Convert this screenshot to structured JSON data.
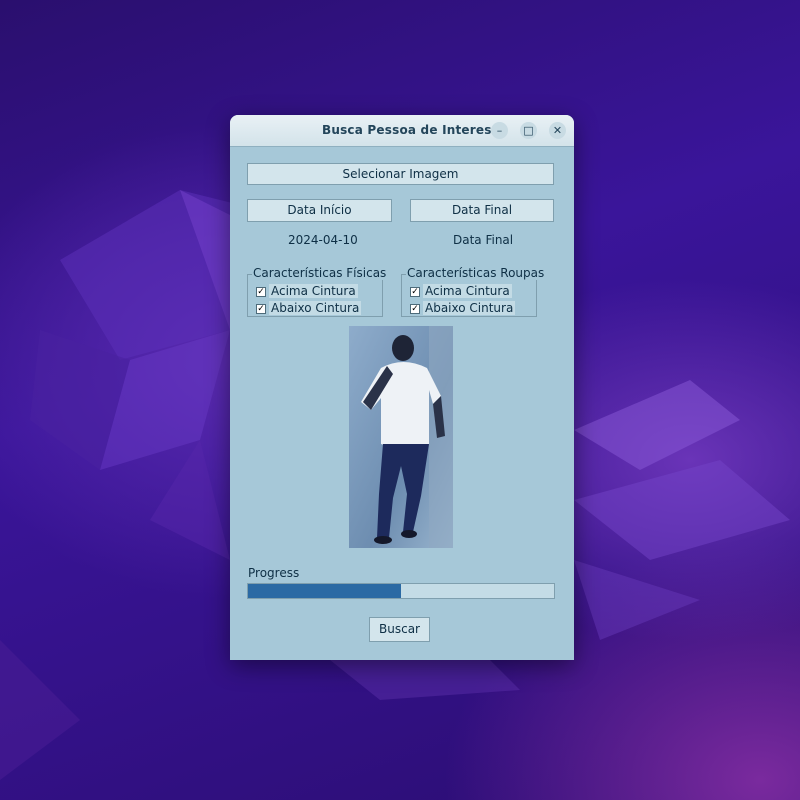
{
  "window": {
    "title": "Busca Pessoa de Interesse"
  },
  "buttons": {
    "select_image": "Selecionar Imagem",
    "start_date": "Data Início",
    "end_date": "Data Final",
    "search": "Buscar"
  },
  "dates": {
    "start_value": "2024-04-10",
    "end_value": "Data Final"
  },
  "physical": {
    "title": "Características Físicas",
    "items": [
      {
        "label": "Acima Cintura",
        "checked": true
      },
      {
        "label": "Abaixo Cintura",
        "checked": true
      }
    ]
  },
  "clothes": {
    "title": "Características Roupas",
    "items": [
      {
        "label": "Acima Cintura",
        "checked": true
      },
      {
        "label": "Abaixo Cintura",
        "checked": true
      }
    ]
  },
  "progress": {
    "label": "Progress",
    "fraction": 0.5
  },
  "colors": {
    "window_bg": "#a6c8d8",
    "progress_fill": "#2b6aa4",
    "desktop_bg": "#2a0f6e"
  }
}
